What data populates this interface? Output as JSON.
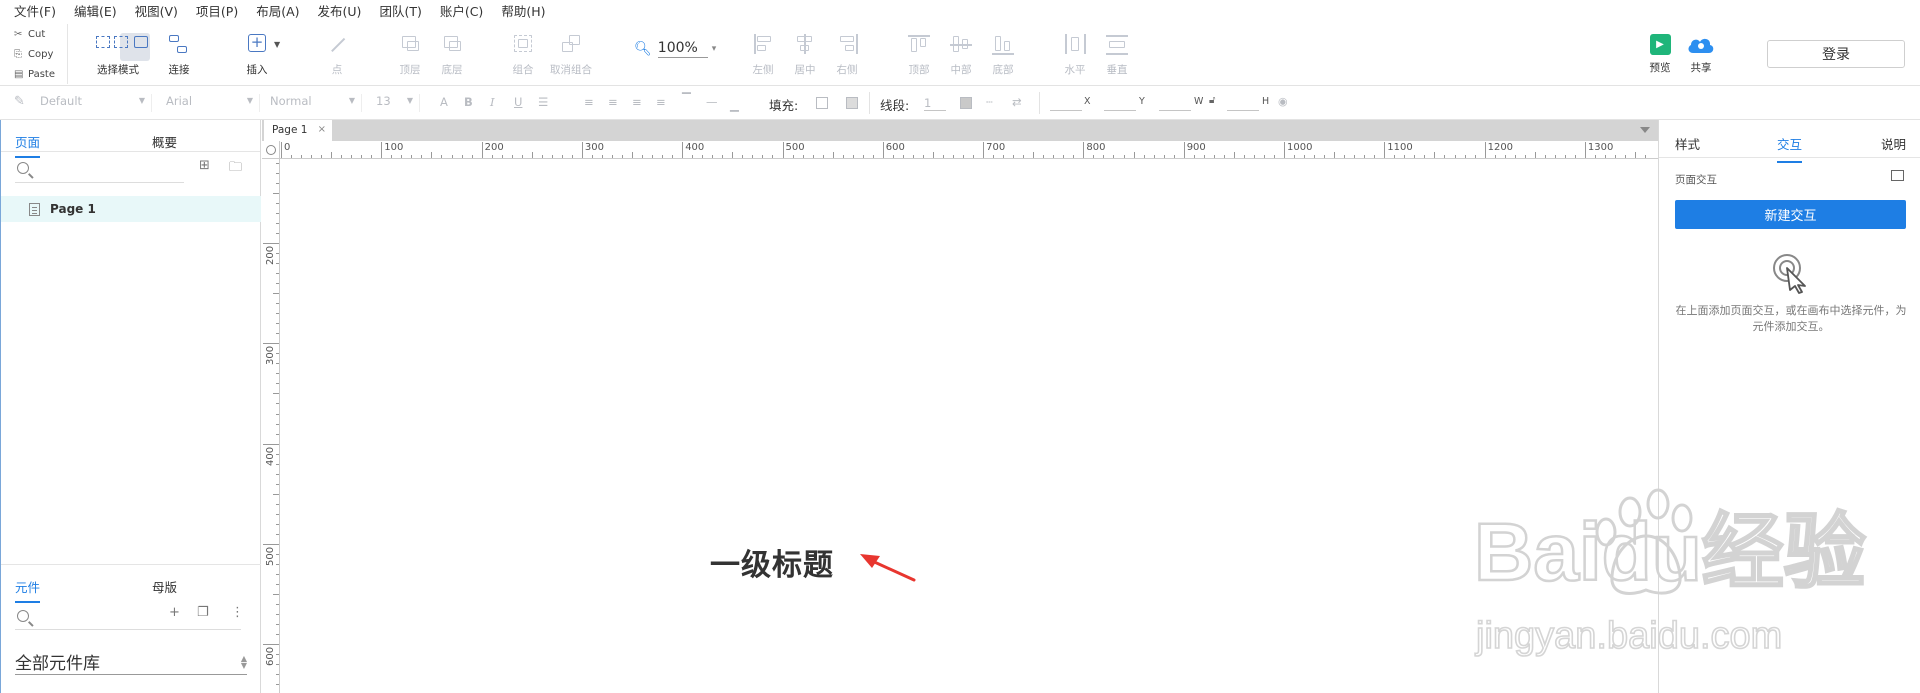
{
  "menu": [
    "文件(F)",
    "编辑(E)",
    "视图(V)",
    "项目(P)",
    "布局(A)",
    "发布(U)",
    "团队(T)",
    "账户(C)",
    "帮助(H)"
  ],
  "clipboard": {
    "cut": "Cut",
    "copy": "Copy",
    "paste": "Paste"
  },
  "toolbar": {
    "select_mode": "选择模式",
    "connect": "连接",
    "insert": "插入",
    "point": "点",
    "top": "顶层",
    "bottom": "底层",
    "group": "组合",
    "ungroup": "取消组合",
    "zoom": "100%",
    "align_left": "左侧",
    "align_center": "居中",
    "align_right": "右侧",
    "align_top": "顶部",
    "align_middle": "中部",
    "align_bottom": "底部",
    "distribute_h": "水平",
    "distribute_v": "垂直",
    "preview": "预览",
    "share": "共享",
    "login": "登录"
  },
  "format": {
    "style": "Default",
    "font": "Arial",
    "weight": "Normal",
    "size": "13",
    "fill_label": "填充:",
    "line_label": "线段:",
    "line_width": "1",
    "x": "X",
    "y": "Y",
    "w": "W",
    "h": "H"
  },
  "left_panel": {
    "tab_pages": "页面",
    "tab_outline": "概要",
    "page_name": "Page 1",
    "tab_widgets": "元件",
    "tab_masters": "母版",
    "library": "全部元件库"
  },
  "canvas": {
    "doc_tab": "Page 1",
    "ruler_h": [
      "0",
      "100",
      "200",
      "300",
      "400",
      "500",
      "600",
      "700",
      "800",
      "900",
      "1000",
      "1100",
      "1200",
      "1300"
    ],
    "ruler_v": [
      "200",
      "300",
      "400",
      "500",
      "600"
    ],
    "heading": "一级标题"
  },
  "right_panel": {
    "tab_style": "样式",
    "tab_interaction": "交互",
    "tab_notes": "说明",
    "page_interaction": "页面交互",
    "new_interaction": "新建交互",
    "help": "在上面添加页面交互，或在画布中选择元件，为元件添加交互。"
  },
  "watermark": {
    "brand": "Baidu经验",
    "url": "jingyan.baidu.com"
  },
  "colors": {
    "accent": "#1e7ee4",
    "preview_green": "#1fb57a",
    "arrow_red": "#e8362f",
    "selected_page_bg": "#e8f8f9"
  }
}
